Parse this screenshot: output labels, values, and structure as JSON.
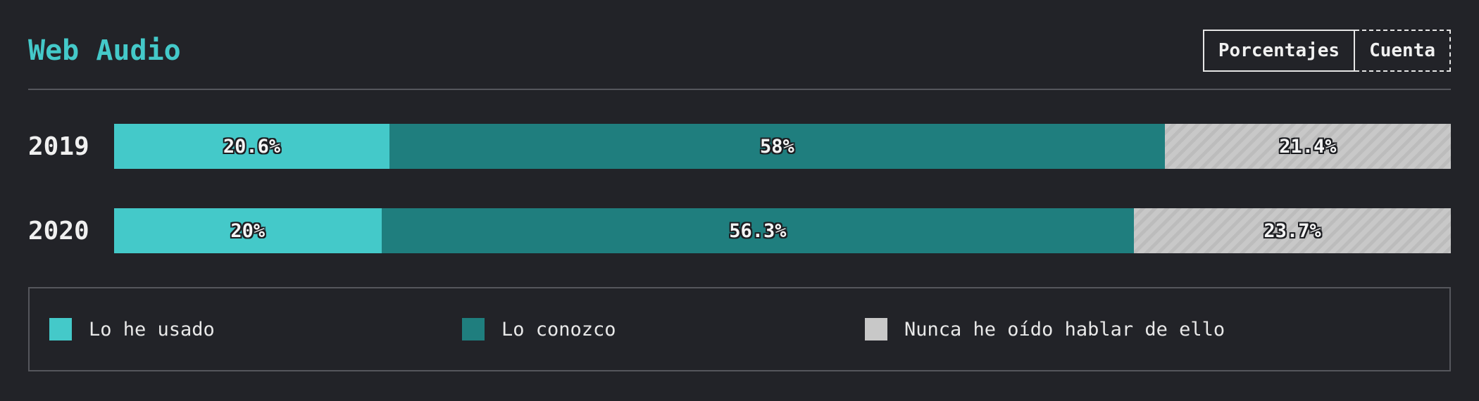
{
  "header": {
    "title": "Web Audio",
    "toggle_percent_label": "Porcentajes",
    "toggle_count_label": "Cuenta"
  },
  "colors": {
    "used": "#44c9c9",
    "heard": "#1f7e7e",
    "never": "#c8c8c8"
  },
  "chart_data": {
    "type": "bar",
    "orientation": "horizontal",
    "stacked": true,
    "title": "Web Audio",
    "categories": [
      "2019",
      "2020"
    ],
    "series": [
      {
        "name": "Lo he usado",
        "values": [
          20.6,
          20.0
        ],
        "labels": [
          "20.6%",
          "20%"
        ]
      },
      {
        "name": "Lo conozco",
        "values": [
          58.0,
          56.3
        ],
        "labels": [
          "58%",
          "56.3%"
        ]
      },
      {
        "name": "Nunca he oído hablar de ello",
        "values": [
          21.4,
          23.7
        ],
        "labels": [
          "21.4%",
          "23.7%"
        ]
      }
    ],
    "xlim": [
      0,
      100
    ],
    "legend_position": "bottom"
  },
  "legend": {
    "items": [
      "Lo he usado",
      "Lo conozco",
      "Nunca he oído hablar de ello"
    ]
  }
}
